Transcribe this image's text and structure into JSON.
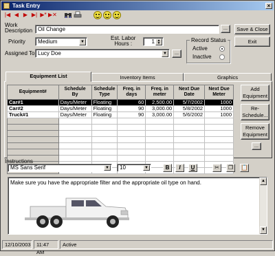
{
  "window": {
    "title": "Task Entry",
    "close_glyph": "×"
  },
  "toolbar": {
    "nav_icons": [
      "first-record-icon",
      "previous-record-icon",
      "next-record-icon",
      "last-record-icon",
      "new-record-icon",
      "delete-record-icon"
    ],
    "nav_glyphs": [
      "|◀",
      "◀",
      "▶",
      "▶|",
      "▶*",
      "▶✕"
    ]
  },
  "form": {
    "work_description_label": "Work\nDescription",
    "work_description_value": "Oil Change",
    "ellipsis": "...",
    "priority_label": "Priority",
    "priority_value": "Medium",
    "est_labor_label": "Est. Labor\nHours :",
    "est_labor_value": "1",
    "assigned_to_label": "Assigned To",
    "assigned_to_value": "Lucy Doe",
    "save_close_label": "Save & Close",
    "exit_label": "Exit",
    "record_status": {
      "title": "Record Status",
      "active_label": "Active",
      "inactive_label": "Inactive",
      "selected": "Active"
    }
  },
  "tabs": [
    {
      "label": "Equipment List",
      "active": true
    },
    {
      "label": "Inventory Items",
      "active": false
    },
    {
      "label": "Graphics",
      "active": false
    }
  ],
  "equipment_table": {
    "headers": [
      "Equipment#",
      "Schedule\nBy",
      "Schedule\nType",
      "Freq. in\ndays",
      "Freq. in\nmeter",
      "Next Due\nDate",
      "Next Due\nMeter"
    ],
    "rows": [
      [
        "Car#1",
        "Days/Meter",
        "Floating",
        "60",
        "2,500.00",
        "5/7/2002",
        "1000"
      ],
      [
        "Car#2",
        "Days/Meter",
        "Floating",
        "90",
        "3,000.00",
        "5/8/2002",
        "1000"
      ],
      [
        "Truck#1",
        "Days/Meter",
        "Floating",
        "90",
        "3,000.00",
        "5/6/2002",
        "1000"
      ]
    ],
    "selected_row": 0,
    "empty_rows": 9
  },
  "side_buttons": {
    "add": "Add\nEquipment",
    "reschedule": "Re-\nSchedule...",
    "remove": "Remove\nEquipment",
    "more": "..."
  },
  "instructions": {
    "label": "Instructions",
    "font_value": "MS Sans Serif",
    "size_value": "10",
    "bold": "B",
    "italic": "I",
    "underline": "U",
    "text": "Make sure you have the appropriate filter and the appropriate oil type on hand."
  },
  "status_bar": {
    "date": "12/10/2003",
    "time": "11:47 AM",
    "state": "Active"
  },
  "colors": {
    "title_start": "#0a246a",
    "title_end": "#a6caf0",
    "selection": "#000000",
    "face": "#d4d0c8"
  }
}
